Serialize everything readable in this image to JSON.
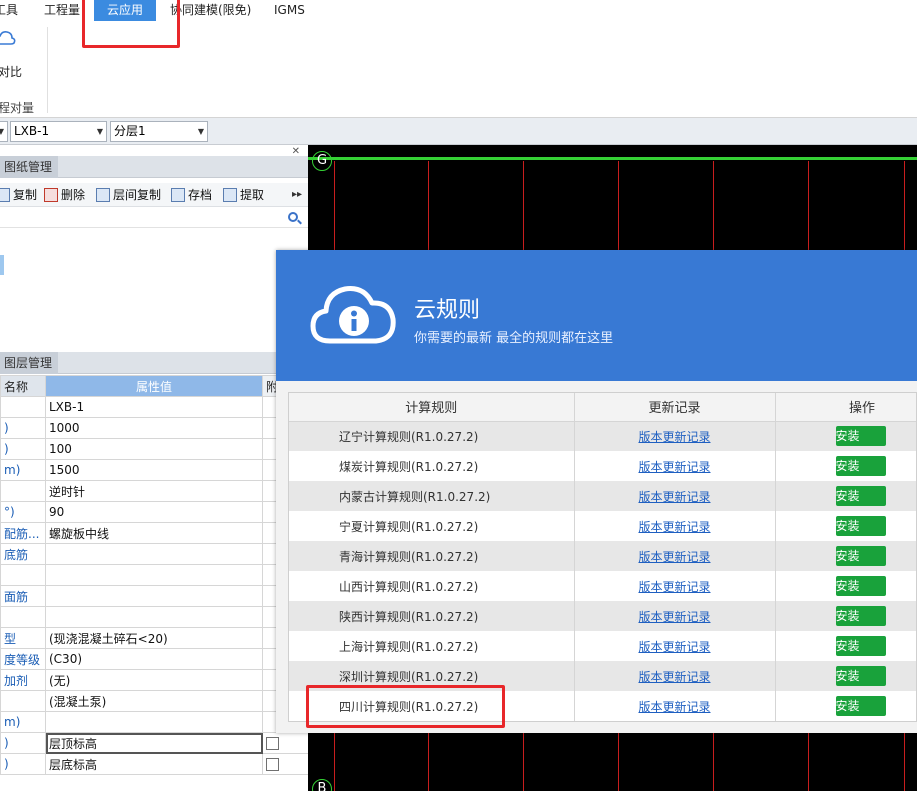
{
  "menu": {
    "tabs": [
      {
        "label": "工具"
      },
      {
        "label": "工程量"
      },
      {
        "label": "云应用"
      },
      {
        "label": "协同建模(限免)"
      },
      {
        "label": "IGMS"
      }
    ]
  },
  "ribbon": {
    "compare_label": "对比",
    "group_label": "程对量"
  },
  "toolbar": {
    "component_select": "LXB-1",
    "layer_select": "分层1"
  },
  "drawings_panel": {
    "title": "图纸管理",
    "buttons": {
      "copy": "复制",
      "delete": "删除",
      "layer_copy": "层间复制",
      "save": "存档",
      "extract": "提取"
    }
  },
  "layers_panel": {
    "title": "图层管理",
    "headers": {
      "name": "名称",
      "value": "属性值",
      "attach": "附"
    },
    "rows": [
      {
        "name": "",
        "value": "LXB-1"
      },
      {
        "name": ")",
        "value": "1000"
      },
      {
        "name": ")",
        "value": "100"
      },
      {
        "name": "m)",
        "value": "1500"
      },
      {
        "name": "",
        "value": "逆时针"
      },
      {
        "name": "°)",
        "value": "90"
      },
      {
        "name": "配筋...",
        "value": "螺旋板中线"
      },
      {
        "name": "底筋",
        "value": ""
      },
      {
        "name": "",
        "value": ""
      },
      {
        "name": "面筋",
        "value": ""
      },
      {
        "name": "",
        "value": ""
      },
      {
        "name": "型",
        "value": "(现浇混凝土碎石<20)"
      },
      {
        "name": "度等级",
        "value": "(C30)"
      },
      {
        "name": "加剂",
        "value": "(无)"
      },
      {
        "name": "",
        "value": "(混凝土泵)"
      },
      {
        "name": "m)",
        "value": ""
      },
      {
        "name": ")",
        "value": "层顶标高"
      },
      {
        "name": ")",
        "value": "层底标高"
      }
    ]
  },
  "canvas": {
    "axis_top": "G",
    "axis_bottom": "B"
  },
  "dialog": {
    "title": "云规则",
    "subtitle": "你需要的最新 最全的规则都在这里",
    "columns": {
      "rule": "计算规则",
      "log": "更新记录",
      "action": "操作"
    },
    "rules": [
      {
        "name": "辽宁计算规则(R1.0.27.2)",
        "log": "版本更新记录",
        "action": "安装"
      },
      {
        "name": "煤炭计算规则(R1.0.27.2)",
        "log": "版本更新记录",
        "action": "安装"
      },
      {
        "name": "内蒙古计算规则(R1.0.27.2)",
        "log": "版本更新记录",
        "action": "安装"
      },
      {
        "name": "宁夏计算规则(R1.0.27.2)",
        "log": "版本更新记录",
        "action": "安装"
      },
      {
        "name": "青海计算规则(R1.0.27.2)",
        "log": "版本更新记录",
        "action": "安装"
      },
      {
        "name": "山西计算规则(R1.0.27.2)",
        "log": "版本更新记录",
        "action": "安装"
      },
      {
        "name": "陕西计算规则(R1.0.27.2)",
        "log": "版本更新记录",
        "action": "安装"
      },
      {
        "name": "上海计算规则(R1.0.27.2)",
        "log": "版本更新记录",
        "action": "安装"
      },
      {
        "name": "深圳计算规则(R1.0.27.2)",
        "log": "版本更新记录",
        "action": "安装"
      },
      {
        "name": "四川计算规则(R1.0.27.2)",
        "log": "版本更新记录",
        "action": "安装"
      }
    ]
  },
  "colors": {
    "accent": "#3879d4",
    "install": "#19a23b",
    "highlight": "#e8272a",
    "link": "#1e5fc1"
  }
}
